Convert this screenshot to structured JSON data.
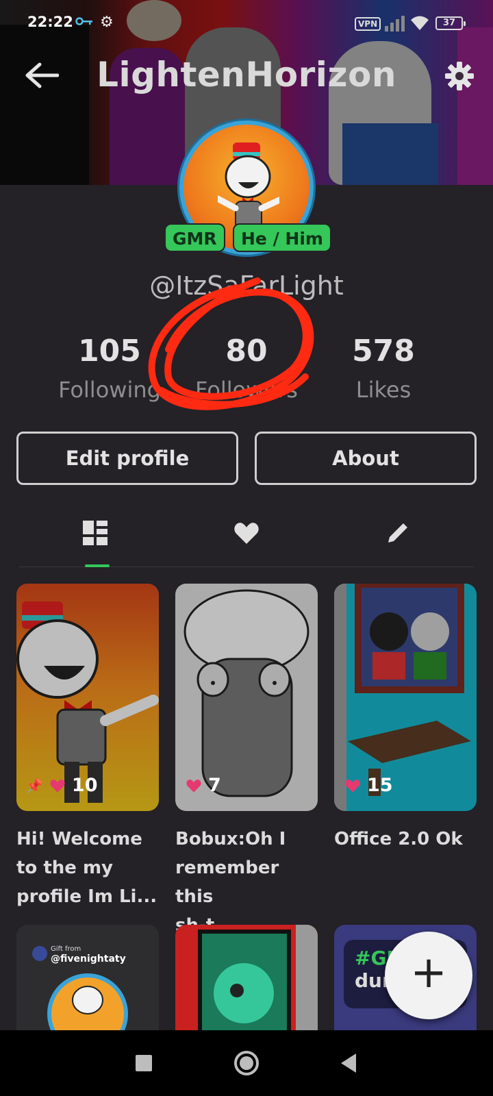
{
  "status_bar": {
    "time": "22:22",
    "vpn": "VPN",
    "battery": "37"
  },
  "header": {
    "title": "LightenHorizon"
  },
  "profile": {
    "badges": [
      "GMR",
      "He / Him"
    ],
    "handle": "@ItzSaFarLight",
    "stats": [
      {
        "value": "105",
        "label": "Following"
      },
      {
        "value": "80",
        "label": "Followers"
      },
      {
        "value": "578",
        "label": "Likes"
      }
    ],
    "edit_label": "Edit profile",
    "about_label": "About"
  },
  "tabs": [
    "posts-tab",
    "likes-tab",
    "drafts-tab"
  ],
  "posts": [
    {
      "likes": "10",
      "title_lines": [
        "Hi! Welcome",
        "to the my",
        "profile Im Li..."
      ],
      "pinned": true
    },
    {
      "likes": "7",
      "title_lines": [
        "Bobux:Oh I",
        "remember this",
        "sh-t"
      ],
      "pinned": false
    },
    {
      "likes": "15",
      "title_lines": [
        "Office 2.0 Ok"
      ],
      "pinned": false
    }
  ],
  "row2": {
    "gift_from": "Gift from",
    "gift_user": "@fivenightaty",
    "tag_line1": "#GJ",
    "tag_line2": "dunn"
  },
  "fab": {
    "icon": "+"
  },
  "colors": {
    "background": "#242127",
    "accent_green": "#35c759",
    "like_heart": "#e6396f",
    "scribble_red": "#ff2a12"
  }
}
